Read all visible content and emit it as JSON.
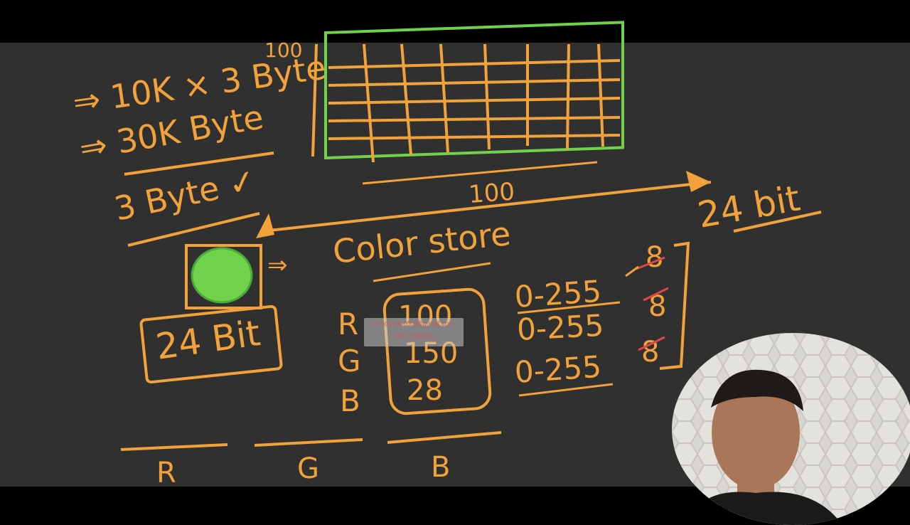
{
  "board": {
    "colors": {
      "background": "#303030",
      "ink": "#f2a23a",
      "green": "#6fd24a",
      "red": "#e0454a"
    },
    "top_left": {
      "line_100": "100",
      "line_10k": "⇒ 10K × 3 Byte",
      "line_30k": "⇒ 30K Byte",
      "label_3byte": "3 Byte ✓"
    },
    "grid_label_100": "100",
    "label_24bit_right": "24 bit",
    "pixel": {
      "label": "24 Bit",
      "arrow": "⇒"
    },
    "color_store": "Color store",
    "rgb_list": [
      {
        "channel": "R",
        "value": "100"
      },
      {
        "channel": "G",
        "value": "150"
      },
      {
        "channel": "B",
        "value": "28"
      }
    ],
    "ranges": [
      {
        "range": "0-255",
        "bits": "8"
      },
      {
        "range": "0-255",
        "bits": "8"
      },
      {
        "range": "0-255",
        "bits": "8"
      }
    ],
    "bottom_labels": [
      "R",
      "G",
      "B"
    ]
  },
  "watermark": {
    "email": "princeinfo053@gmail.com",
    "phone": "8987298956"
  },
  "webcam": {
    "icon": "person-icon"
  }
}
